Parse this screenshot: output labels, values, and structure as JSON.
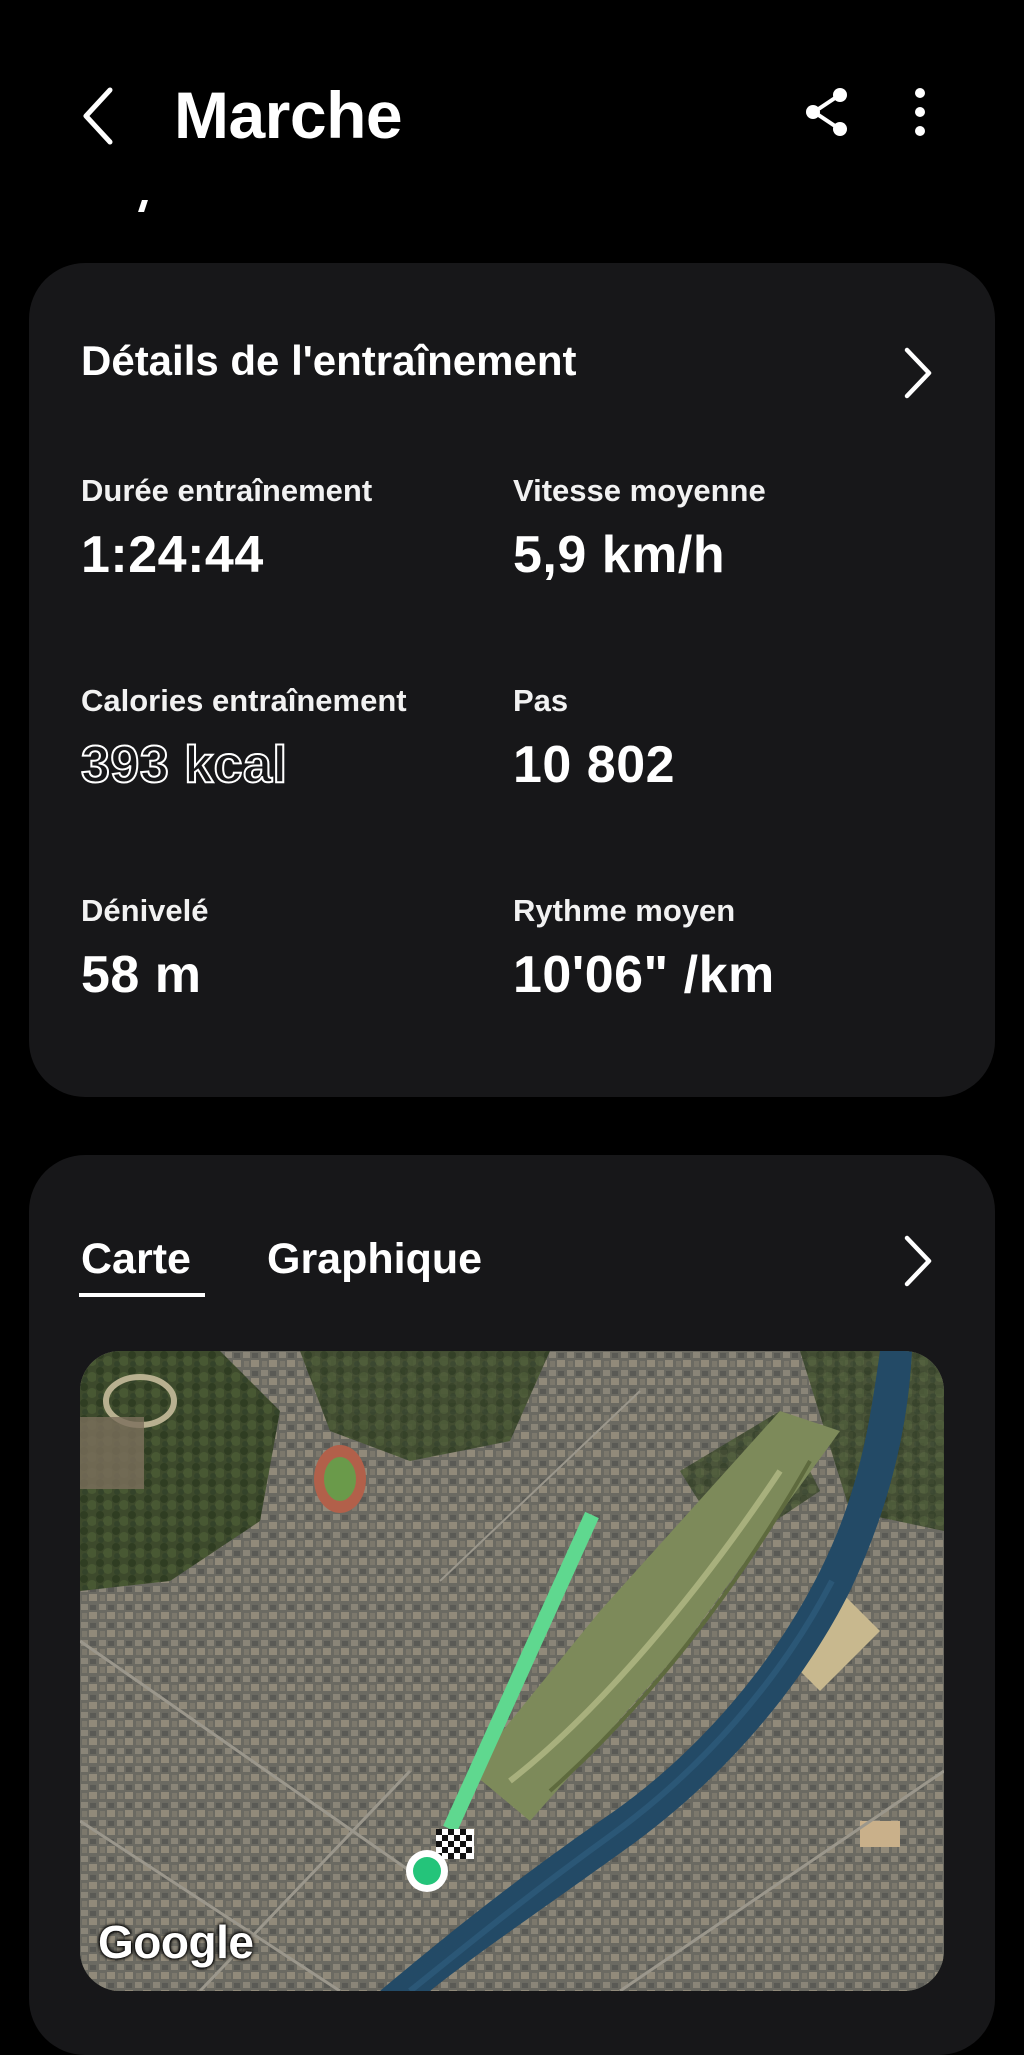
{
  "header": {
    "title": "Marche",
    "back_icon": "chevron-left-icon",
    "share_icon": "share-icon",
    "more_icon": "more-vertical-icon"
  },
  "details": {
    "title": "Détails de l'entraînement",
    "metrics": [
      {
        "label": "Durée entraînement",
        "value": "1:24:44"
      },
      {
        "label": "Vitesse moyenne",
        "value": "5,9 km/h"
      },
      {
        "label": "Calories entraînement",
        "value": "393 kcal"
      },
      {
        "label": "Pas",
        "value": "10 802"
      },
      {
        "label": "Dénivelé",
        "value": "58 m"
      },
      {
        "label": "Rythme moyen",
        "value": "10'06\" /km"
      }
    ]
  },
  "map_card": {
    "tabs": [
      {
        "label": "Carte",
        "selected": true
      },
      {
        "label": "Graphique",
        "selected": false
      }
    ],
    "attribution": "Google",
    "route_color": "#5fd88f",
    "start_marker_color": "#24c47a"
  },
  "colors": {
    "background": "#000000",
    "card": "#171719",
    "text": "#ffffff"
  }
}
